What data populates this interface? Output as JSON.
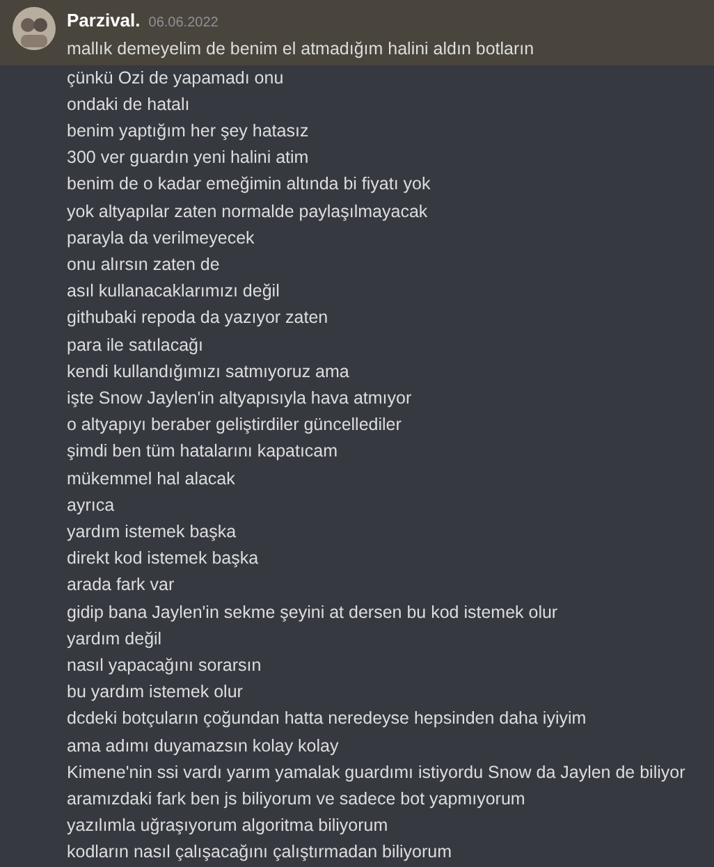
{
  "message": {
    "author": "Parzival.",
    "timestamp": "06.06.2022",
    "highlighted": true,
    "lines": [
      "mallık demeyelim de benim el atmadığım halini aldın botların",
      "çünkü Ozi de yapamadı onu",
      "ondaki de hatalı",
      "benim yaptığım her şey hatasız",
      "300 ver guardın yeni halini atim",
      "benim de o kadar emeğimin altında bi fiyatı yok",
      "yok altyapılar zaten normalde paylaşılmayacak",
      "parayla da verilmeyecek",
      "onu alırsın zaten de",
      "asıl kullanacaklarımızı değil",
      "githubaki repoda da yazıyor zaten",
      "para ile satılacağı",
      "kendi kullandığımızı satmıyoruz ama",
      "işte Snow Jaylen'in altyapısıyla hava atmıyor",
      "o altyapıyı beraber geliştirdiler güncellediler",
      "şimdi ben tüm hatalarını kapatıcam",
      "mükemmel hal alacak",
      "ayrıca",
      "yardım istemek başka",
      "direkt kod istemek başka",
      "arada fark var",
      "gidip bana Jaylen'in sekme şeyini at dersen bu kod istemek olur",
      "yardım değil",
      "nasıl yapacağını sorarsın",
      "bu yardım istemek olur",
      "dcdeki botçuların çoğundan hatta neredeyse hepsinden daha iyiyim",
      "ama adımı duyamazsın kolay kolay",
      "Kimene'nin ssi vardı yarım yamalak guardımı istiyordu Snow da Jaylen de biliyor",
      "aramızdaki fark ben js biliyorum ve sadece bot yapmıyorum",
      "yazılımla uğraşıyorum algoritma biliyorum",
      "kodların nasıl çalışacağını çalıştırmadan biliyorum"
    ]
  }
}
